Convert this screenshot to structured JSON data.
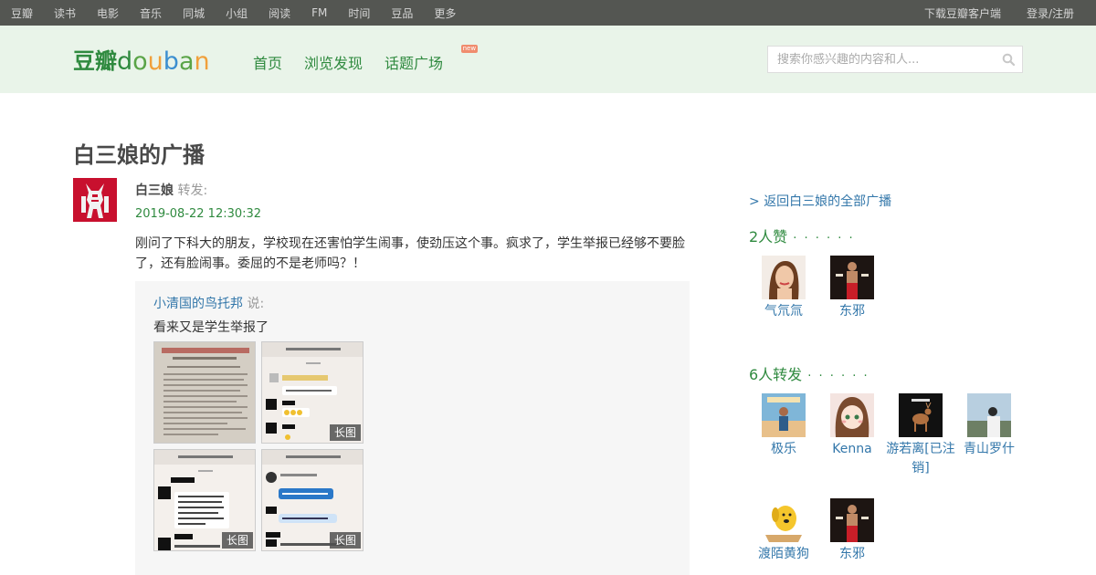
{
  "topbar": {
    "nav": [
      "豆瓣",
      "读书",
      "电影",
      "音乐",
      "同城",
      "小组",
      "阅读",
      "FM",
      "时间",
      "豆品",
      "更多"
    ],
    "download": "下载豆瓣客户端",
    "login": "登录/注册"
  },
  "header": {
    "logo_cn": "豆瓣",
    "logo_en": "douban",
    "nav": [
      "首页",
      "浏览发现",
      "话题广场"
    ],
    "new_badge": "new",
    "search_placeholder": "搜索你感兴趣的内容和人..."
  },
  "page": {
    "title": "白三娘的广播",
    "author": "白三娘",
    "action": "转发:",
    "time": "2019-08-22 12:30:32",
    "text": "刚问了下科大的朋友，学校现在还害怕学生闹事，使劲压这个事。疯求了，学生举报已经够不要脸了，还有脸闹事。委屈的不是老师吗？！"
  },
  "quote": {
    "author": "小清国的鸟托邦",
    "says": "说:",
    "text": "看来又是学生举报了",
    "long_tag": "长图"
  },
  "sidebar": {
    "back_link": "返回白三娘的全部广播",
    "likes_title": "2人赞",
    "likers": [
      "气氘氚",
      "东邪"
    ],
    "reshares_title": "6人转发",
    "resharers": [
      "极乐",
      "Kenna",
      "游若离[已注销]",
      "青山罗什",
      "渡陌黄狗",
      "东邪"
    ],
    "more_dots": "· · · · · ·"
  },
  "colors": {
    "green": "#2f8a3f",
    "link": "#3377aa",
    "topbar": "#545652",
    "header_bg": "#e9f4e9"
  }
}
